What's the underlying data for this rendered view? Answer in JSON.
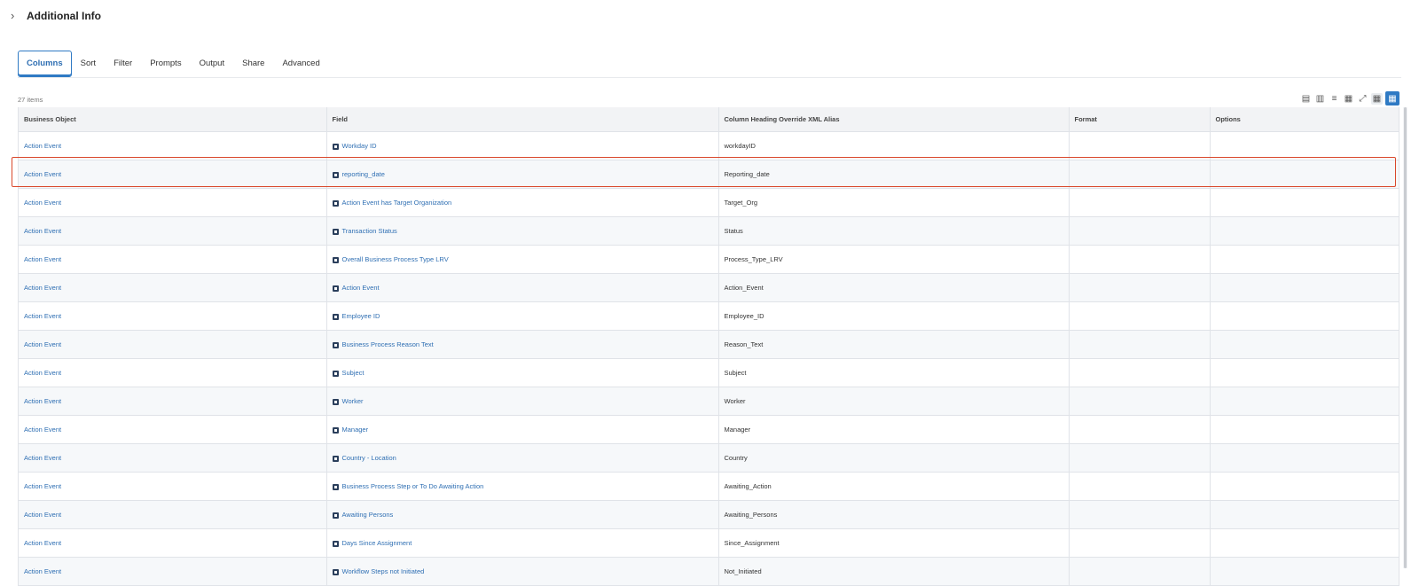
{
  "section": {
    "title": "Additional Info"
  },
  "tabs": [
    {
      "label": "Columns",
      "active": true
    },
    {
      "label": "Sort"
    },
    {
      "label": "Filter"
    },
    {
      "label": "Prompts"
    },
    {
      "label": "Output"
    },
    {
      "label": "Share"
    },
    {
      "label": "Advanced"
    }
  ],
  "grid": {
    "count_label": "27 items",
    "headers": [
      "Business Object",
      "Field",
      "Column Heading Override XML Alias",
      "Format",
      "Options"
    ],
    "rows": [
      {
        "bo": "Action Event",
        "field": "Workday ID",
        "alias": "workdayID",
        "format": "",
        "options": ""
      },
      {
        "bo": "Action Event",
        "field": "reporting_date",
        "alias": "Reporting_date",
        "format": "",
        "options": ""
      },
      {
        "bo": "Action Event",
        "field": "Action Event has Target Organization",
        "alias": "Target_Org",
        "format": "",
        "options": ""
      },
      {
        "bo": "Action Event",
        "field": "Transaction Status",
        "alias": "Status",
        "format": "",
        "options": ""
      },
      {
        "bo": "Action Event",
        "field": "Overall Business Process Type LRV",
        "alias": "Process_Type_LRV",
        "format": "",
        "options": ""
      },
      {
        "bo": "Action Event",
        "field": "Action Event",
        "alias": "Action_Event",
        "format": "",
        "options": ""
      },
      {
        "bo": "Action Event",
        "field": "Employee ID",
        "alias": "Employee_ID",
        "format": "",
        "options": ""
      },
      {
        "bo": "Action Event",
        "field": "Business Process Reason Text",
        "alias": "Reason_Text",
        "format": "",
        "options": ""
      },
      {
        "bo": "Action Event",
        "field": "Subject",
        "alias": "Subject",
        "format": "",
        "options": ""
      },
      {
        "bo": "Action Event",
        "field": "Worker",
        "alias": "Worker",
        "format": "",
        "options": ""
      },
      {
        "bo": "Action Event",
        "field": "Manager",
        "alias": "Manager",
        "format": "",
        "options": ""
      },
      {
        "bo": "Action Event",
        "field": "Country - Location",
        "alias": "Country",
        "format": "",
        "options": ""
      },
      {
        "bo": "Action Event",
        "field": "Business Process Step or To Do Awaiting Action",
        "alias": "Awaiting_Action",
        "format": "",
        "options": ""
      },
      {
        "bo": "Action Event",
        "field": "Awaiting Persons",
        "alias": "Awaiting_Persons",
        "format": "",
        "options": ""
      },
      {
        "bo": "Action Event",
        "field": "Days Since Assignment",
        "alias": "Since_Assignment",
        "format": "",
        "options": ""
      },
      {
        "bo": "Action Event",
        "field": "Workflow Steps not Initiated",
        "alias": "Not_Initiated",
        "format": "",
        "options": ""
      }
    ]
  },
  "toolbar": {
    "icons": [
      "export-excel-icon",
      "export-pdf-icon",
      "filter-icon",
      "columns-icon",
      "fullscreen-icon",
      "table-view-icon",
      "grid-view-icon"
    ]
  }
}
